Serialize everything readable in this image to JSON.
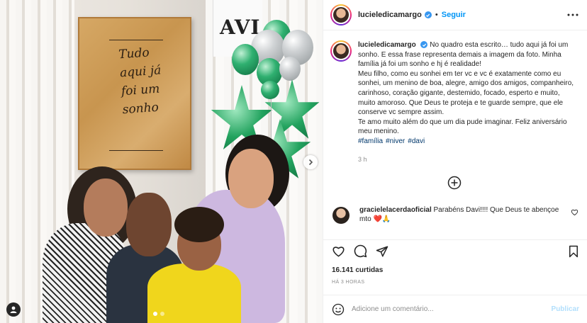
{
  "post": {
    "username": "lucieledicamargo",
    "separator": "•",
    "follow_label": "Seguir",
    "photo_frame_text": "Tudo aqui já foi um sonho",
    "banner_text": "AVI"
  },
  "caption": {
    "username": "lucieledicamargo",
    "text": "No quadro esta escrito… tudo aqui já foi um sonho. E essa frase representa demais a imagem da foto. Minha família já foi um sonho e hj é realidade!\nMeu filho, como eu sonhei em ter vc e vc é exatamente como eu sonhei, um menino de boa, alegre, amigo dos amigos, companheiro, carinhoso, coração gigante, destemido, focado, esperto e muito, muito amoroso. Que Deus te proteja e te guarde sempre, que ele conserve vc sempre assim.\nTe amo muito além do que um dia pude imaginar. Feliz aniversário meu menino.",
    "hashtags": [
      "#família",
      "#niver",
      "#davi"
    ],
    "time": "3 h"
  },
  "comment": {
    "username": "gracielelacerdaoficial",
    "text": "Parabéns Davi!!!! Que Deus te abençoe mto ❤️🙏"
  },
  "likes": "16.141 curtidas",
  "date": "HÁ 3 HORAS",
  "add_comment": {
    "placeholder": "Adicione um comentário...",
    "publish_label": "Publicar"
  },
  "colors": {
    "link_blue": "#0095f6",
    "verified_blue": "#3897f0",
    "hashtag_blue": "#00376b",
    "publish_disabled": "#b2dffc",
    "muted_gray": "#8e8e8e"
  }
}
